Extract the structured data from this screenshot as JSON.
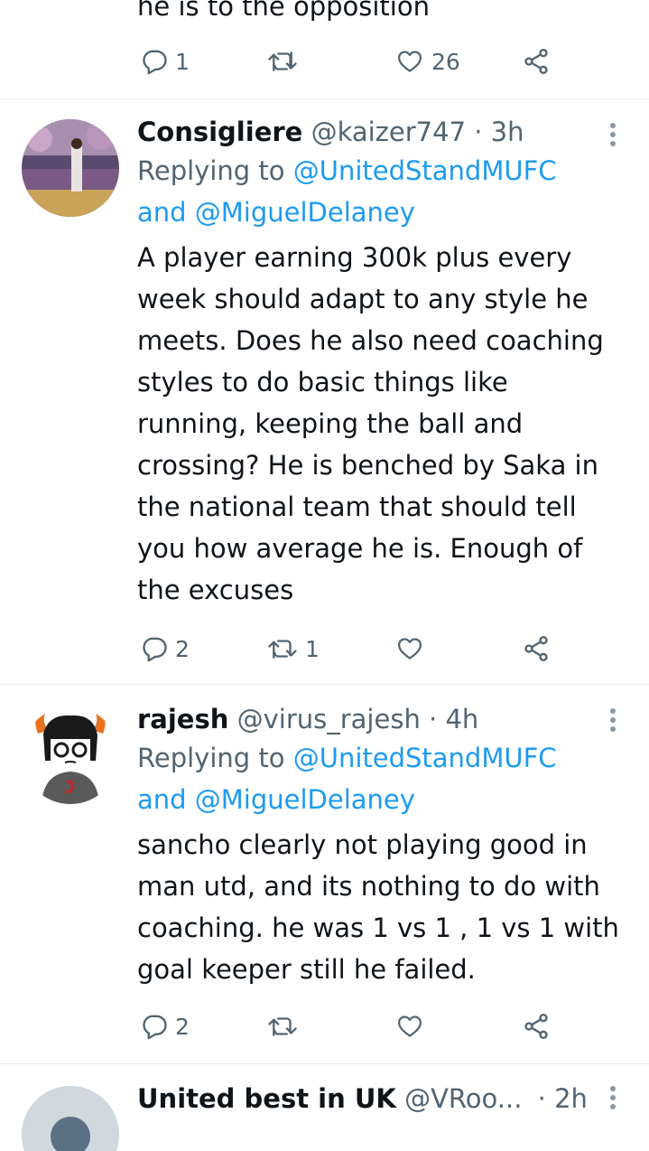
{
  "partial_top_tweet": {
    "text": "he is to the opposition",
    "reply_count": "1",
    "retweet_count": "",
    "like_count": "26"
  },
  "tweets": [
    {
      "name": "Consigliere",
      "handle": "@kaizer747",
      "dot": "·",
      "time": "3h",
      "replying_prefix": "Replying to",
      "mention1": "@UnitedStandMUFC",
      "and": "and",
      "mention2": "@MiguelDelaney",
      "text_lines": [
        "A player earning 300k plus every",
        "week should adapt to any style he",
        "meets. Does he also need coaching",
        "styles to do basic things like",
        "running, keeping the ball and",
        "crossing? He is benched by Saka in",
        "the national team that should tell",
        "you how average he is. Enough of",
        "the excuses"
      ],
      "reply_count": "2",
      "retweet_count": "1",
      "like_count": ""
    },
    {
      "name": "rajesh",
      "handle": "@virus_rajesh",
      "dot": "·",
      "time": "4h",
      "replying_prefix": "Replying to",
      "mention1": "@UnitedStandMUFC",
      "and": "and",
      "mention2": "@MiguelDelaney",
      "text_lines": [
        "sancho clearly not playing good in",
        "man utd, and its nothing to do with",
        "coaching. he was 1 vs 1 , 1 vs 1 with",
        "goal keeper still he failed."
      ],
      "reply_count": "2",
      "retweet_count": "",
      "like_count": ""
    },
    {
      "name": "United best in UK",
      "handle": "@VRoo...",
      "dot": "·",
      "time": "2h"
    }
  ],
  "icons": {
    "reply": "reply-icon",
    "retweet": "retweet-icon",
    "like": "heart-icon",
    "share": "share-icon",
    "more": "more-options-icon"
  },
  "colors": {
    "link": "#1d9bf0",
    "secondary": "#536471",
    "divider": "#e6ecf0"
  }
}
